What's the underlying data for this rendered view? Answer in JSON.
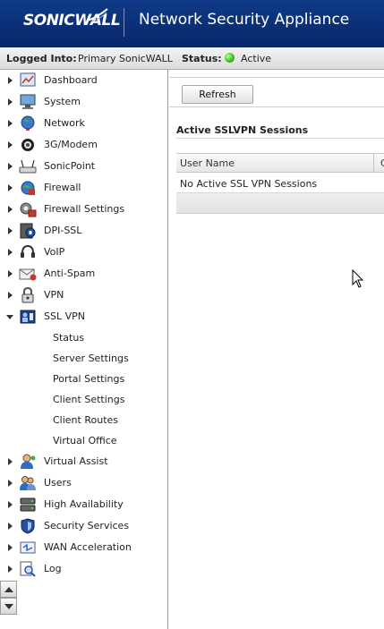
{
  "header": {
    "logo_text": "SONICWALL",
    "app_title": "Network Security Appliance"
  },
  "status_bar": {
    "logged_into_label": "Logged Into:",
    "logged_into_value": "Primary SonicWALL",
    "status_label": "Status:",
    "status_value": "Active",
    "status_color": "#3fc21c"
  },
  "sidebar": {
    "items": [
      {
        "label": "Dashboard",
        "icon": "dashboard-icon"
      },
      {
        "label": "System",
        "icon": "monitor-icon"
      },
      {
        "label": "Network",
        "icon": "globe-icon"
      },
      {
        "label": "3G/Modem",
        "icon": "modem-icon"
      },
      {
        "label": "SonicPoint",
        "icon": "access-point-icon"
      },
      {
        "label": "Firewall",
        "icon": "firewall-globe-icon"
      },
      {
        "label": "Firewall Settings",
        "icon": "firewall-settings-icon"
      },
      {
        "label": "DPI-SSL",
        "icon": "dpi-ssl-icon"
      },
      {
        "label": "VoIP",
        "icon": "headset-icon"
      },
      {
        "label": "Anti-Spam",
        "icon": "envelope-icon"
      },
      {
        "label": "VPN",
        "icon": "padlock-icon"
      },
      {
        "label": "SSL VPN",
        "icon": "ssl-vpn-icon"
      },
      {
        "label": "Virtual Assist",
        "icon": "assist-person-icon"
      },
      {
        "label": "Users",
        "icon": "users-icon"
      },
      {
        "label": "High Availability",
        "icon": "servers-icon"
      },
      {
        "label": "Security Services",
        "icon": "shield-icon"
      },
      {
        "label": "WAN Acceleration",
        "icon": "wan-acceleration-icon"
      },
      {
        "label": "Log",
        "icon": "magnifier-log-icon"
      }
    ],
    "ssl_vpn_subitems": [
      "Status",
      "Server Settings",
      "Portal Settings",
      "Client Settings",
      "Client Routes",
      "Virtual Office"
    ]
  },
  "main": {
    "refresh_label": "Refresh",
    "section_title": "Active SSLVPN Sessions",
    "table": {
      "columns": [
        "User Name",
        "C"
      ],
      "empty_message": "No Active SSL VPN Sessions"
    }
  }
}
